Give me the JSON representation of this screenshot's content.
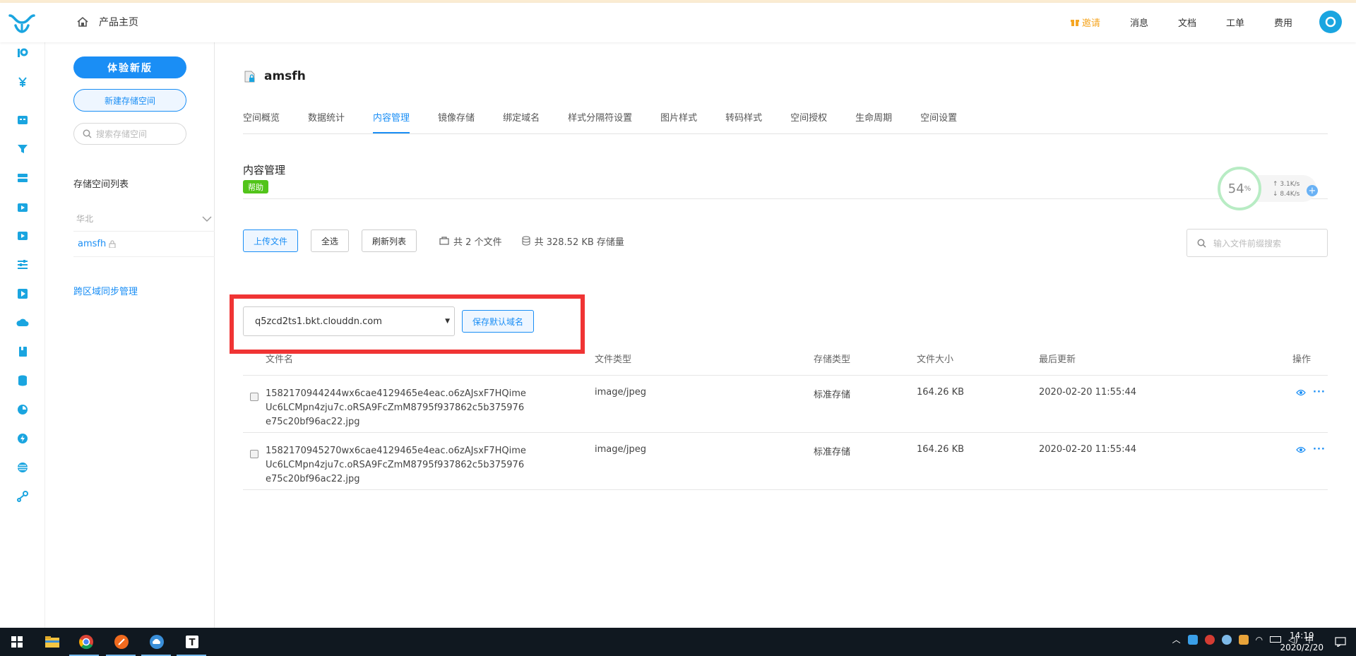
{
  "topbar": {
    "home_label": "产品主页",
    "nav": {
      "invite": "邀请",
      "messages": "消息",
      "docs": "文档",
      "tickets": "工单",
      "billing": "费用"
    },
    "accent_color": "#1a8ef5",
    "invite_color": "#f5a623"
  },
  "sidebar": {
    "try_new": "体验新版",
    "new_bucket": "新建存储空间",
    "search_placeholder": "搜索存储空间",
    "list_title": "存储空间列表",
    "region": "华北",
    "bucket_name": "amsfh",
    "cross_region": "跨区域同步管理"
  },
  "main": {
    "bucket_title": "amsfh",
    "tabs": [
      {
        "label": "空间概览"
      },
      {
        "label": "数据统计"
      },
      {
        "label": "内容管理",
        "active": true
      },
      {
        "label": "镜像存储"
      },
      {
        "label": "绑定域名"
      },
      {
        "label": "样式分隔符设置"
      },
      {
        "label": "图片样式"
      },
      {
        "label": "转码样式"
      },
      {
        "label": "空间授权"
      },
      {
        "label": "生命周期"
      },
      {
        "label": "空间设置"
      }
    ],
    "section_title": "内容管理",
    "help": "帮助",
    "speed": {
      "percent": "54",
      "unit": "%",
      "up": "3.1K/s",
      "down": "8.4K/s"
    },
    "toolbar": {
      "upload": "上传文件",
      "select_all": "全选",
      "refresh": "刷新列表",
      "file_count": "共 2 个文件",
      "storage": "共 328.52 KB 存储量",
      "search_placeholder": "输入文件前缀搜索"
    },
    "domain_select": "q5zcd2ts1.bkt.clouddn.com",
    "save_domain": "保存默认域名",
    "table": {
      "headers": {
        "name": "文件名",
        "type": "文件类型",
        "storage": "存储类型",
        "size": "文件大小",
        "updated": "最后更新",
        "ops": "操作"
      },
      "rows": [
        {
          "name": "1582170944244wx6cae4129465e4eac.o6zAJsxF7HQimeUc6LCMpn4zju7c.oRSA9FcZmM8795f937862c5b375976e75c20bf96ac22.jpg",
          "type": "image/jpeg",
          "storage": "标准存储",
          "size": "164.26 KB",
          "updated": "2020-02-20 11:55:44"
        },
        {
          "name": "1582170945270wx6cae4129465e4eac.o6zAJsxF7HQimeUc6LCMpn4zju7c.oRSA9FcZmM8795f937862c5b375976e75c20bf96ac22.jpg",
          "type": "image/jpeg",
          "storage": "标准存储",
          "size": "164.26 KB",
          "updated": "2020-02-20 11:55:44"
        }
      ]
    }
  },
  "taskbar": {
    "time": "14:19",
    "date": "2020/2/20",
    "ime": "中",
    "apps": [
      "windows-start-icon",
      "file-explorer-icon",
      "chrome-icon",
      "sublime-icon",
      "cloud-icon",
      "typora-icon"
    ]
  }
}
